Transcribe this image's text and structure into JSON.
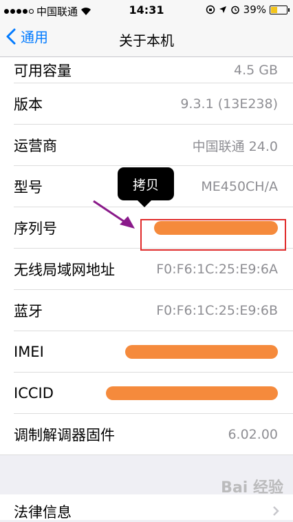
{
  "status_bar": {
    "carrier": "中国联通",
    "time": "14:31",
    "battery": "39%",
    "battery_level": 0.39,
    "battery_color": "#f3c41a"
  },
  "nav": {
    "back_label": "通用",
    "title": "关于本机"
  },
  "rows": [
    {
      "label": "可用容量",
      "value": "4.5 GB"
    },
    {
      "label": "版本",
      "value": "9.3.1 (13E238)"
    },
    {
      "label": "运营商",
      "value": "中国联通 24.0"
    },
    {
      "label": "型号",
      "value": "ME450CH/A"
    },
    {
      "label": "序列号",
      "value": ""
    },
    {
      "label": "无线局域网地址",
      "value": "F0:F6:1C:25:E9:6A"
    },
    {
      "label": "蓝牙",
      "value": "F0:F6:1C:25:E9:6B"
    },
    {
      "label": "IMEI",
      "value": ""
    },
    {
      "label": "ICCID",
      "value": ""
    },
    {
      "label": "调制解调器固件",
      "value": "6.02.00"
    }
  ],
  "legal": {
    "label": "法律信息"
  },
  "tooltip": {
    "label": "拷贝"
  },
  "watermark": "Bai 经验",
  "colors": {
    "accent": "#007aff",
    "highlight": "#e02a2a",
    "arrow": "#8a1a8a",
    "redaction": "#f58a3c"
  }
}
